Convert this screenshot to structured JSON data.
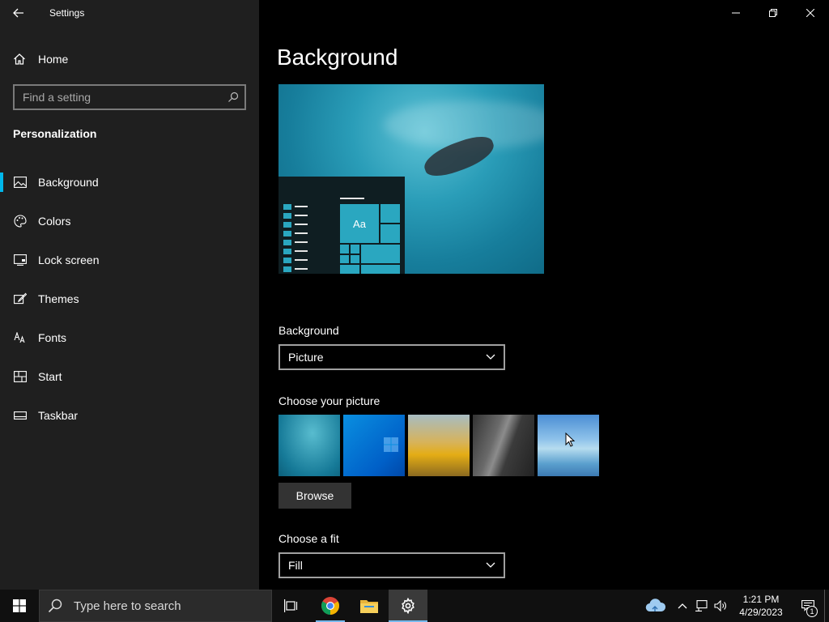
{
  "window": {
    "title": "Settings"
  },
  "sidebar": {
    "home_label": "Home",
    "search_placeholder": "Find a setting",
    "section_title": "Personalization",
    "items": [
      {
        "label": "Background",
        "icon": "picture-icon",
        "active": true
      },
      {
        "label": "Colors",
        "icon": "palette-icon"
      },
      {
        "label": "Lock screen",
        "icon": "lock-screen-icon"
      },
      {
        "label": "Themes",
        "icon": "brush-icon"
      },
      {
        "label": "Fonts",
        "icon": "font-icon"
      },
      {
        "label": "Start",
        "icon": "start-icon"
      },
      {
        "label": "Taskbar",
        "icon": "taskbar-icon"
      }
    ]
  },
  "main": {
    "title": "Background",
    "preview_tile_text": "Aa",
    "background_label": "Background",
    "background_value": "Picture",
    "choose_picture_label": "Choose your picture",
    "browse_label": "Browse",
    "fit_label": "Choose a fit",
    "fit_value": "Fill"
  },
  "taskbar": {
    "search_placeholder": "Type here to search",
    "time": "1:21 PM",
    "date": "4/29/2023",
    "notification_count": "1"
  },
  "colors": {
    "accent": "#00b7eb",
    "sidebar_bg": "#1f1f1f",
    "main_bg": "#000000"
  }
}
